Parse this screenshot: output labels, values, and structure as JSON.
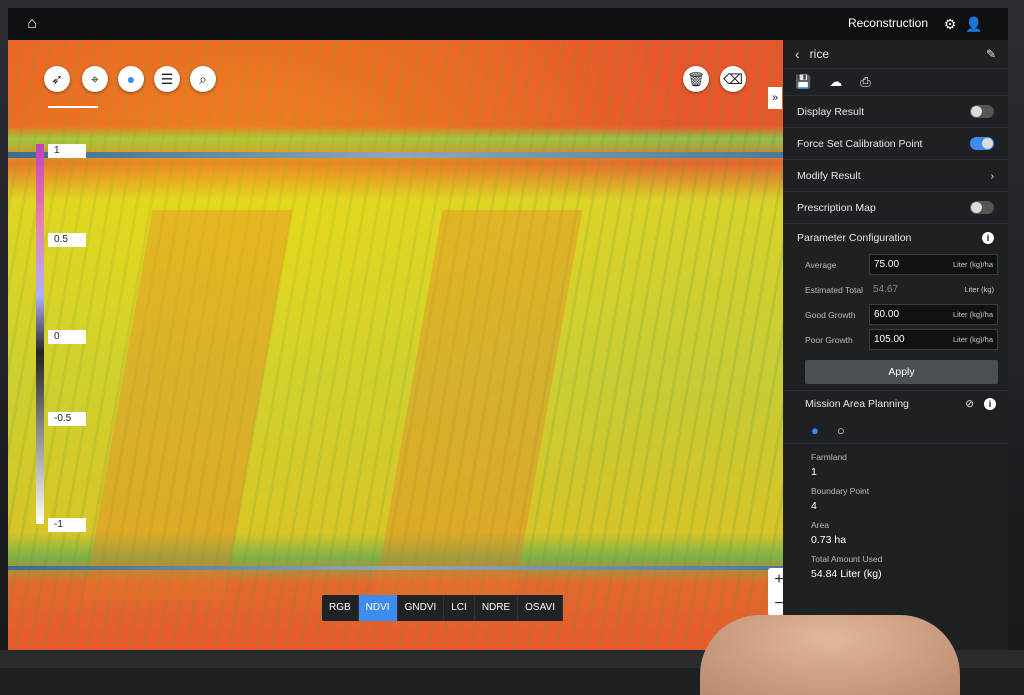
{
  "topbar": {
    "title": "Reconstruction"
  },
  "map": {
    "legend_ticks": [
      "1",
      "0.5",
      "0",
      "-0.5",
      "-1"
    ],
    "index_tabs": [
      "RGB",
      "NDVI",
      "GNDVI",
      "LCI",
      "NDRE",
      "OSAVI"
    ],
    "active_index": "NDVI",
    "zoom_in": "+",
    "zoom_out": "−",
    "collapse": "»"
  },
  "panel": {
    "name": "rice",
    "display_result": {
      "label": "Display Result",
      "on": false
    },
    "force_calibration": {
      "label": "Force Set Calibration Point",
      "on": true
    },
    "modify_result": {
      "label": "Modify Result"
    },
    "prescription_map": {
      "label": "Prescription Map",
      "on": false
    },
    "parameter_configuration": {
      "label": "Parameter Configuration"
    },
    "params": [
      {
        "label": "Average",
        "value": "75.00",
        "unit": "Liter (kg)/ha"
      },
      {
        "label": "Estimated Total",
        "value": "54.67",
        "unit": "Liter (kg)"
      },
      {
        "label": "Good Growth",
        "value": "60.00",
        "unit": "Liter (kg)/ha"
      },
      {
        "label": "Poor Growth",
        "value": "105.00",
        "unit": "Liter (kg)/ha"
      }
    ],
    "apply_label": "Apply",
    "mission_area_planning": {
      "label": "Mission Area Planning"
    },
    "stats": [
      {
        "label": "Farmland",
        "value": "1"
      },
      {
        "label": "Boundary Point",
        "value": "4"
      },
      {
        "label": "Area",
        "value": "0.73 ha"
      },
      {
        "label": "Total Amount Used",
        "value": "54.84 Liter (kg)"
      }
    ]
  },
  "colors": {
    "accent": "#3f8cf0"
  }
}
